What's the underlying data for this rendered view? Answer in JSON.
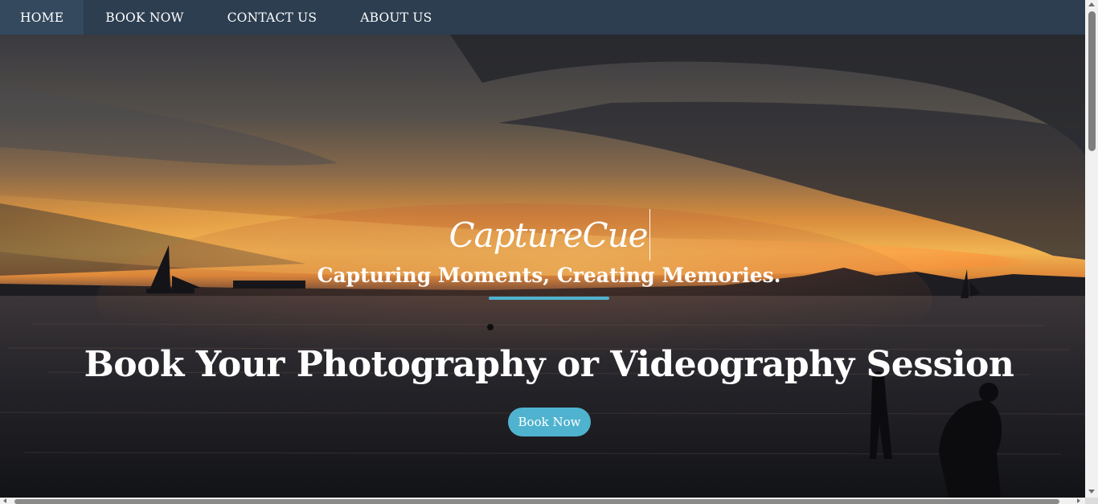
{
  "nav": {
    "items": [
      {
        "label": "HOME",
        "active": true
      },
      {
        "label": "BOOK NOW",
        "active": false
      },
      {
        "label": "CONTACT US",
        "active": false
      },
      {
        "label": "ABOUT US",
        "active": false
      }
    ]
  },
  "hero": {
    "brand": "CaptureCue",
    "tagline": "Capturing Moments, Creating Memories.",
    "headline": "Book Your Photography or Videography Session",
    "cta_label": "Book Now",
    "background_image": "sunset-beach-photo"
  },
  "colors": {
    "nav_bg": "#2c3e50",
    "nav_active_bg": "#34495e",
    "accent": "#4fb3cf",
    "text": "#ffffff"
  }
}
